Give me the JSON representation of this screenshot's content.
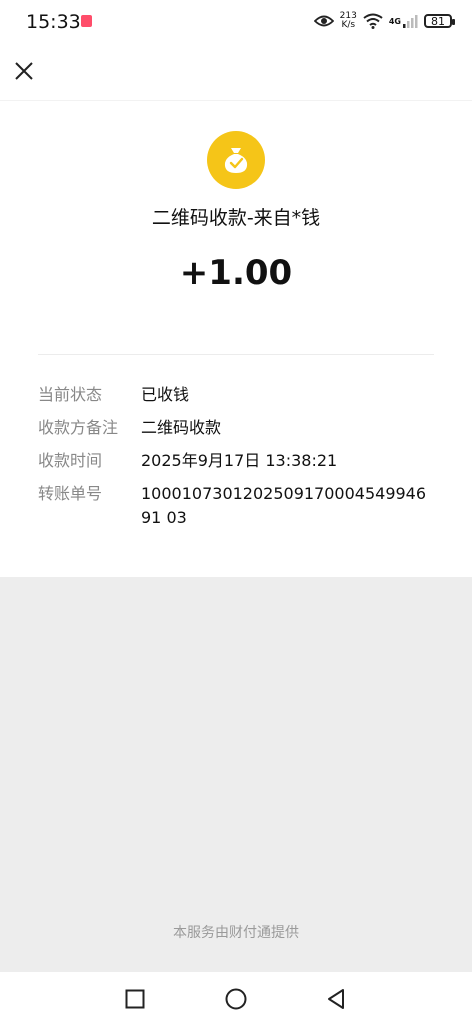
{
  "status_bar": {
    "time": "15:33",
    "network_speed_value": "213",
    "network_speed_unit": "K/s",
    "network_type": "4G",
    "battery": "81"
  },
  "transaction": {
    "title": "二维码收款-来自*钱",
    "amount": "+1.00",
    "details": [
      {
        "label": "当前状态",
        "value": "已收钱"
      },
      {
        "label": "收款方备注",
        "value": "二维码收款"
      },
      {
        "label": "收款时间",
        "value": "2025年9月17日 13:38:21"
      },
      {
        "label": "转账单号",
        "value": "100010730120250917000454994691 03"
      }
    ]
  },
  "footer": {
    "provider_note": "本服务由财付通提供"
  },
  "colors": {
    "coin": "#f5c518",
    "background": "#ededed"
  }
}
